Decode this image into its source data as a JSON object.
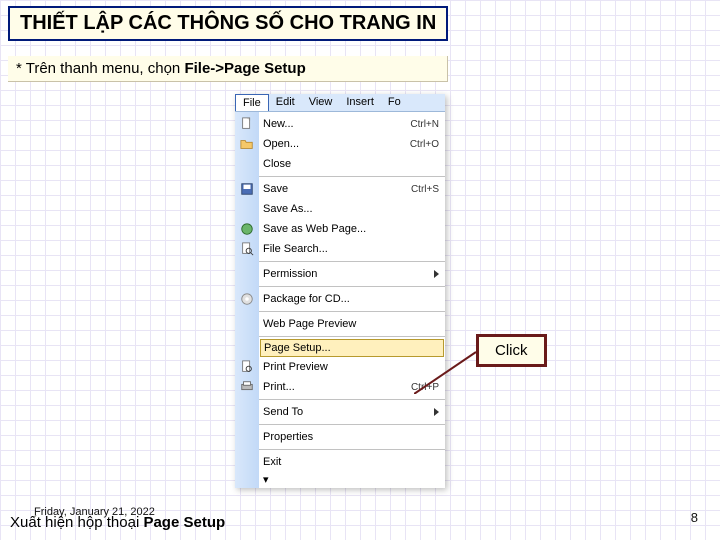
{
  "title": "THIẾT LẬP CÁC THÔNG SỐ CHO TRANG IN",
  "instruction_prefix": "* Trên thanh menu, chọn ",
  "instruction_bold": "File->Page Setup",
  "menubar": {
    "file": "File",
    "edit": "Edit",
    "view": "View",
    "insert": "Insert",
    "fo": "Fo"
  },
  "menu": {
    "new": "New...",
    "new_sc": "Ctrl+N",
    "open": "Open...",
    "open_sc": "Ctrl+O",
    "close": "Close",
    "save": "Save",
    "save_sc": "Ctrl+S",
    "saveas": "Save As...",
    "saveweb": "Save as Web Page...",
    "filesearch": "File Search...",
    "permission": "Permission",
    "package": "Package for CD...",
    "webprev": "Web Page Preview",
    "pagesetup": "Page Setup...",
    "printprev": "Print Preview",
    "print": "Print...",
    "print_sc": "Ctrl+P",
    "sendto": "Send To",
    "properties": "Properties",
    "exit": "Exit"
  },
  "click_label": "Click",
  "date": "Friday, January 21, 2022",
  "bottom_prefix": "Xuất hiện hộp thoại ",
  "bottom_bold": "Page Setup",
  "page_number": "8"
}
